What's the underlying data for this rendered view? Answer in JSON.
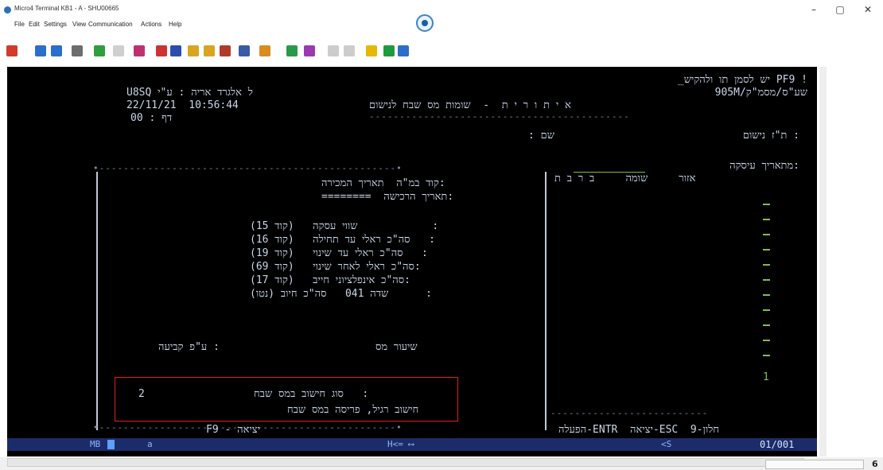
{
  "window": {
    "title": "Micro4 Terminal KB1 - A - SHU00665",
    "minimize": "–",
    "maximize": "▢",
    "close": "✕"
  },
  "menu": [
    "File",
    "Edit",
    "Settings",
    "View",
    "Communication",
    "Actions",
    "Help"
  ],
  "toolbar_colors": [
    "#d23b2a",
    "#2a6fc9",
    "#2a6fc9",
    "#6d6d6d",
    "#2e9e3e",
    "#cfcfcf",
    "#c03070",
    "#c33",
    "#2c4db0",
    "#d9a520",
    "#d9a520",
    "#b03a2a",
    "#3a5aa8",
    "#d98a20",
    "#2a9a4a",
    "#9a3ab0",
    "#cccccc",
    "#cccccc",
    "#e6b800",
    "#1f9a3e",
    "#2a6fc9"
  ],
  "terminal": {
    "line_header1": "_יש לסמן תו ולהקיש PF9 !",
    "user_line": "U8SQ ל אלגרד אריה : ע\"י",
    "screen_code": "905M/שע\"ס/מסמ\"ק",
    "datetime": "22/11/21  10:56:44",
    "title": "א י ת ו ר י ת  -  שומות מס שבח לנישום",
    "page_label": "00 : דף",
    "id_label": "ת\"ז נישום :",
    "name_label": ": שם",
    "trans_desc_label": "מתאריך עיסקה:",
    "col_headers_right": "אזור     שומה     ב ר ב ת",
    "sale_date": "קוד במ\"ה  תאריך המכירה:",
    "purchase_date": "========  תאריך הרכישה:",
    "codes": [
      "(קוד 15)   שווי עסקה            :",
      "(קוד 16)   סה\"כ ראלי עד תחילה   :",
      "(קוד 19)   סה\"כ ראלי עד שינוי   :",
      "(קוד 69)   סה\"כ ראלי לאחר שינוי:",
      "(קוד 17)   סה\"כ אינפלציוני חייב:",
      "שדה 041   סה\"כ חיוב (נטו)      :"
    ],
    "tax_rate": "שיעור מס",
    "fixed_label": "ע\"פ קביעה :",
    "calc_type_value": "2",
    "calc_type_label": "סוג חישוב במס שבח   :",
    "calc_type_desc": "חישוב רגיל, פריסה במס שבח",
    "footer_left": "F9 - יציאה",
    "footer_right": "הפעלה-ENTR  יציאה-ESC  חלון-9",
    "green_one": "1"
  },
  "status_bar": {
    "mode": "MB",
    "session": "a",
    "h_indicator": "H<= ⟷",
    "s_indicator": "<S",
    "position": "01/001"
  },
  "bottom": {
    "page_number": "6"
  }
}
